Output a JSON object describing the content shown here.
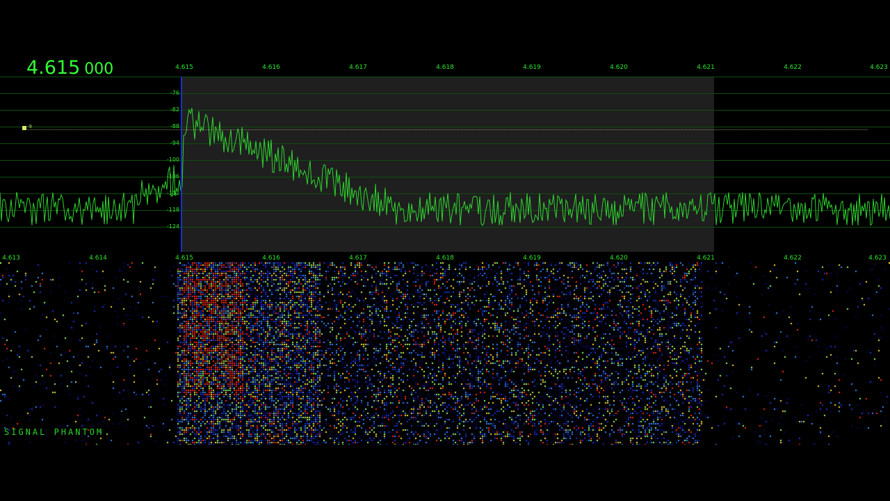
{
  "frequency_readout": {
    "main": "4.615",
    "sub": "000"
  },
  "top_scale": {
    "labels": [
      "4.615",
      "4.616",
      "4.617",
      "4.618",
      "4.619",
      "4.620",
      "4.621",
      "4.622",
      "4.623"
    ]
  },
  "bottom_scale": {
    "labels": [
      "4.613",
      "4.614",
      "4.615",
      "4.616",
      "4.617",
      "4.618",
      "4.619",
      "4.620",
      "4.621",
      "4.622",
      "4.623"
    ]
  },
  "db_scale": {
    "labels": [
      "-76",
      "-82",
      "-88",
      "-94",
      "-100",
      "-106",
      "-112",
      "-118",
      "-124"
    ]
  },
  "squelch": {
    "label": "-9"
  },
  "watermark": "SIGNAL PHANTOM",
  "colors": {
    "background": "#000000",
    "trace": "#2fd62f",
    "grid": "#0f4d10",
    "passband": "#2a2a2a",
    "tuned_marker": "#1a33c8",
    "waterfall_low": "#0a0a5a",
    "waterfall_mid": "#1f4fff",
    "waterfall_high": "#ffe23a",
    "waterfall_peak": "#ff2a1a"
  }
}
